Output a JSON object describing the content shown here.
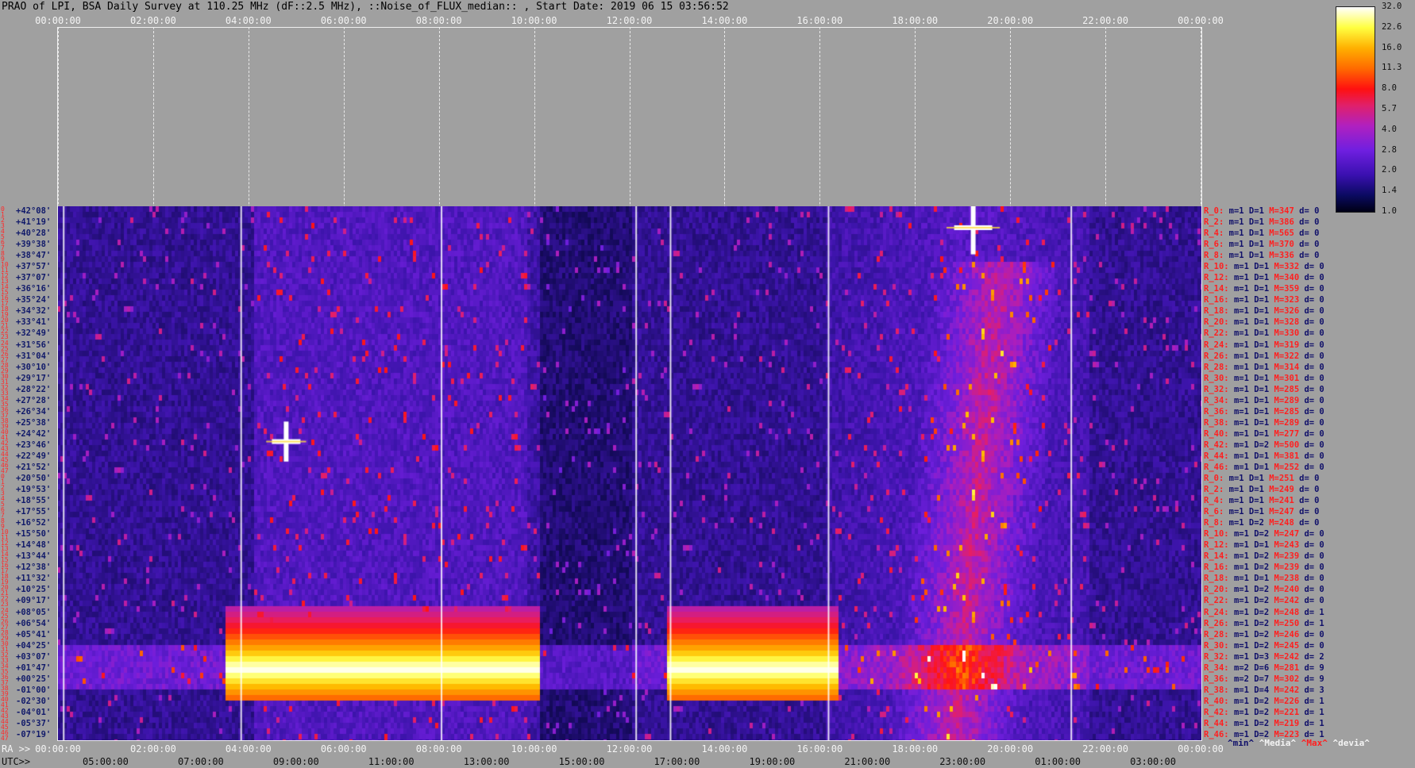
{
  "title": "PRAO of LPI, BSA Daily Survey at 110.25 MHz (dF::2.5 MHz), ::Noise_of_FLUX_median:: , Start Date: 2019 06 15 03:56:52",
  "top_axis": [
    "00:00:00",
    "02:00:00",
    "04:00:00",
    "06:00:00",
    "08:00:00",
    "10:00:00",
    "12:00:00",
    "14:00:00",
    "16:00:00",
    "18:00:00",
    "20:00:00",
    "22:00:00",
    "00:00:00"
  ],
  "ra_axis": {
    "prefix": "RA >>",
    "labels": [
      "00:00:00",
      "02:00:00",
      "04:00:00",
      "06:00:00",
      "08:00:00",
      "10:00:00",
      "12:00:00",
      "14:00:00",
      "16:00:00",
      "18:00:00",
      "20:00:00",
      "22:00:00",
      "00:00:00"
    ]
  },
  "utc_axis": {
    "prefix": "UTC>>",
    "labels": [
      "05:00:00",
      "07:00:00",
      "09:00:00",
      "11:00:00",
      "13:00:00",
      "15:00:00",
      "17:00:00",
      "19:00:00",
      "21:00:00",
      "23:00:00",
      "01:00:00",
      "03:00:00"
    ]
  },
  "declinations": [
    "+42°08'",
    "+41°19'",
    "+40°28'",
    "+39°38'",
    "+38°47'",
    "+37°57'",
    "+37°07'",
    "+36°16'",
    "+35°24'",
    "+34°32'",
    "+33°41'",
    "+32°49'",
    "+31°56'",
    "+31°04'",
    "+30°10'",
    "+29°17'",
    "+28°22'",
    "+27°28'",
    "+26°34'",
    "+25°38'",
    "+24°42'",
    "+23°46'",
    "+22°49'",
    "+21°52'",
    "+20°50'",
    "+19°53'",
    "+18°55'",
    "+17°55'",
    "+16°52'",
    "+15°50'",
    "+14°48'",
    "+13°44'",
    "+12°38'",
    "+11°32'",
    "+10°25'",
    "+09°17'",
    "+08°05'",
    "+06°54'",
    "+05°41'",
    "+04°25'",
    "+03°07'",
    "+01°47'",
    "+00°25'",
    "-01°00'",
    "-02°30'",
    "-04°01'",
    "-05°37'",
    "-07°19'"
  ],
  "row_index_labels": [
    "0",
    "1",
    "2",
    "3",
    "4",
    "5",
    "6",
    "7",
    "8",
    "9",
    "10",
    "11",
    "12",
    "13",
    "14",
    "15",
    "16",
    "17",
    "18",
    "19",
    "20",
    "21",
    "22",
    "23",
    "24",
    "25",
    "26",
    "27",
    "28",
    "29",
    "30",
    "31",
    "32",
    "33",
    "34",
    "35",
    "36",
    "37",
    "38",
    "39",
    "40",
    "41",
    "42",
    "43",
    "44",
    "45",
    "46",
    "47",
    "0",
    "1",
    "2",
    "3",
    "4",
    "5",
    "6",
    "7",
    "8",
    "9",
    "10",
    "11",
    "12",
    "13",
    "14",
    "15",
    "16",
    "17",
    "18",
    "19",
    "20",
    "21",
    "22",
    "23",
    "24",
    "25",
    "26",
    "27",
    "28",
    "29",
    "30",
    "31",
    "32",
    "33",
    "34",
    "35",
    "36",
    "37",
    "38",
    "39",
    "40",
    "41",
    "42",
    "43",
    "44",
    "45",
    "46",
    "47"
  ],
  "row_stats": [
    {
      "r": "R_0:",
      "m": "m=1",
      "D": "D=1",
      "M": "M=347",
      "d": "d= 0"
    },
    {
      "r": "R_2:",
      "m": "m=1",
      "D": "D=1",
      "M": "M=386",
      "d": "d= 0"
    },
    {
      "r": "R_4:",
      "m": "m=1",
      "D": "D=1",
      "M": "M=565",
      "d": "d= 0"
    },
    {
      "r": "R_6:",
      "m": "m=1",
      "D": "D=1",
      "M": "M=370",
      "d": "d= 0"
    },
    {
      "r": "R_8:",
      "m": "m=1",
      "D": "D=1",
      "M": "M=336",
      "d": "d= 0"
    },
    {
      "r": "R_10:",
      "m": "m=1",
      "D": "D=1",
      "M": "M=332",
      "d": "d= 0"
    },
    {
      "r": "R_12:",
      "m": "m=1",
      "D": "D=1",
      "M": "M=340",
      "d": "d= 0"
    },
    {
      "r": "R_14:",
      "m": "m=1",
      "D": "D=1",
      "M": "M=359",
      "d": "d= 0"
    },
    {
      "r": "R_16:",
      "m": "m=1",
      "D": "D=1",
      "M": "M=323",
      "d": "d= 0"
    },
    {
      "r": "R_18:",
      "m": "m=1",
      "D": "D=1",
      "M": "M=326",
      "d": "d= 0"
    },
    {
      "r": "R_20:",
      "m": "m=1",
      "D": "D=1",
      "M": "M=328",
      "d": "d= 0"
    },
    {
      "r": "R_22:",
      "m": "m=1",
      "D": "D=1",
      "M": "M=330",
      "d": "d= 0"
    },
    {
      "r": "R_24:",
      "m": "m=1",
      "D": "D=1",
      "M": "M=319",
      "d": "d= 0"
    },
    {
      "r": "R_26:",
      "m": "m=1",
      "D": "D=1",
      "M": "M=322",
      "d": "d= 0"
    },
    {
      "r": "R_28:",
      "m": "m=1",
      "D": "D=1",
      "M": "M=314",
      "d": "d= 0"
    },
    {
      "r": "R_30:",
      "m": "m=1",
      "D": "D=1",
      "M": "M=301",
      "d": "d= 0"
    },
    {
      "r": "R_32:",
      "m": "m=1",
      "D": "D=1",
      "M": "M=285",
      "d": "d= 0"
    },
    {
      "r": "R_34:",
      "m": "m=1",
      "D": "D=1",
      "M": "M=289",
      "d": "d= 0"
    },
    {
      "r": "R_36:",
      "m": "m=1",
      "D": "D=1",
      "M": "M=285",
      "d": "d= 0"
    },
    {
      "r": "R_38:",
      "m": "m=1",
      "D": "D=1",
      "M": "M=289",
      "d": "d= 0"
    },
    {
      "r": "R_40:",
      "m": "m=1",
      "D": "D=1",
      "M": "M=277",
      "d": "d= 0"
    },
    {
      "r": "R_42:",
      "m": "m=1",
      "D": "D=2",
      "M": "M=500",
      "d": "d= 0"
    },
    {
      "r": "R_44:",
      "m": "m=1",
      "D": "D=1",
      "M": "M=381",
      "d": "d= 0"
    },
    {
      "r": "R_46:",
      "m": "m=1",
      "D": "D=1",
      "M": "M=252",
      "d": "d= 0"
    },
    {
      "r": "R_0:",
      "m": "m=1",
      "D": "D=1",
      "M": "M=251",
      "d": "d= 0"
    },
    {
      "r": "R_2:",
      "m": "m=1",
      "D": "D=1",
      "M": "M=249",
      "d": "d= 0"
    },
    {
      "r": "R_4:",
      "m": "m=1",
      "D": "D=1",
      "M": "M=241",
      "d": "d= 0"
    },
    {
      "r": "R_6:",
      "m": "m=1",
      "D": "D=1",
      "M": "M=247",
      "d": "d= 0"
    },
    {
      "r": "R_8:",
      "m": "m=1",
      "D": "D=2",
      "M": "M=248",
      "d": "d= 0"
    },
    {
      "r": "R_10:",
      "m": "m=1",
      "D": "D=2",
      "M": "M=247",
      "d": "d= 0"
    },
    {
      "r": "R_12:",
      "m": "m=1",
      "D": "D=1",
      "M": "M=243",
      "d": "d= 0"
    },
    {
      "r": "R_14:",
      "m": "m=1",
      "D": "D=2",
      "M": "M=239",
      "d": "d= 0"
    },
    {
      "r": "R_16:",
      "m": "m=1",
      "D": "D=2",
      "M": "M=239",
      "d": "d= 0"
    },
    {
      "r": "R_18:",
      "m": "m=1",
      "D": "D=1",
      "M": "M=238",
      "d": "d= 0"
    },
    {
      "r": "R_20:",
      "m": "m=1",
      "D": "D=2",
      "M": "M=240",
      "d": "d= 0"
    },
    {
      "r": "R_22:",
      "m": "m=1",
      "D": "D=2",
      "M": "M=242",
      "d": "d= 0"
    },
    {
      "r": "R_24:",
      "m": "m=1",
      "D": "D=2",
      "M": "M=248",
      "d": "d= 1"
    },
    {
      "r": "R_26:",
      "m": "m=1",
      "D": "D=2",
      "M": "M=250",
      "d": "d= 1"
    },
    {
      "r": "R_28:",
      "m": "m=1",
      "D": "D=2",
      "M": "M=246",
      "d": "d= 0"
    },
    {
      "r": "R_30:",
      "m": "m=1",
      "D": "D=2",
      "M": "M=245",
      "d": "d= 0"
    },
    {
      "r": "R_32:",
      "m": "m=1",
      "D": "D=3",
      "M": "M=242",
      "d": "d= 2"
    },
    {
      "r": "R_34:",
      "m": "m=2",
      "D": "D=6",
      "M": "M=281",
      "d": "d= 9"
    },
    {
      "r": "R_36:",
      "m": "m=2",
      "D": "D=7",
      "M": "M=302",
      "d": "d= 9"
    },
    {
      "r": "R_38:",
      "m": "m=1",
      "D": "D=4",
      "M": "M=242",
      "d": "d= 3"
    },
    {
      "r": "R_40:",
      "m": "m=1",
      "D": "D=2",
      "M": "M=226",
      "d": "d= 1"
    },
    {
      "r": "R_42:",
      "m": "m=1",
      "D": "D=2",
      "M": "M=221",
      "d": "d= 1"
    },
    {
      "r": "R_44:",
      "m": "m=1",
      "D": "D=2",
      "M": "M=219",
      "d": "d= 1"
    },
    {
      "r": "R_46:",
      "m": "m=1",
      "D": "D=2",
      "M": "M=223",
      "d": "d= 1"
    }
  ],
  "legend_foot": {
    "min": "^min^",
    "media": "^Media^",
    "max": "^Max^",
    "devia": "^devia^"
  },
  "colorbar": {
    "ticks": [
      "32.0",
      "22.6",
      "16.0",
      "11.3",
      "8.0",
      "5.7",
      "4.0",
      "2.8",
      "2.0",
      "1.4",
      "1.0"
    ]
  },
  "colors": {
    "background": "#a0a0a0",
    "stats_red": "#ff2020",
    "stats_blue": "#10106a",
    "dec_blue": "#111a6a"
  },
  "chart_data": {
    "type": "heatmap",
    "title": "PRAO of LPI, BSA Daily Survey at 110.25 MHz (dF::2.5 MHz), ::Noise_of_FLUX_median:: , Start Date: 2019 06 15 03:56:52",
    "x_ra": [
      "00:00:00",
      "02:00:00",
      "04:00:00",
      "06:00:00",
      "08:00:00",
      "10:00:00",
      "12:00:00",
      "14:00:00",
      "16:00:00",
      "18:00:00",
      "20:00:00",
      "22:00:00",
      "00:00:00"
    ],
    "x_utc": [
      "05:00:00",
      "07:00:00",
      "09:00:00",
      "11:00:00",
      "13:00:00",
      "15:00:00",
      "17:00:00",
      "19:00:00",
      "21:00:00",
      "23:00:00",
      "01:00:00",
      "03:00:00"
    ],
    "y_declination_range": [
      "+42°08'",
      "-07°19'"
    ],
    "colorbar_range": [
      1.0,
      32.0
    ],
    "colorbar_scale": "log2"
  }
}
